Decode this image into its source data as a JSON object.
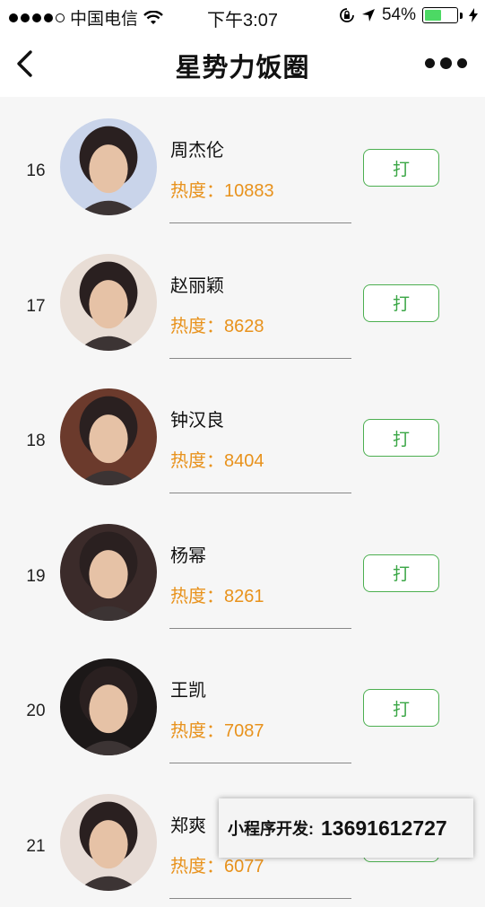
{
  "status_bar": {
    "carrier": "中国电信",
    "time": "下午3:07",
    "battery": "54%",
    "battery_level": 0.54,
    "icons": [
      "signal-dots-icon",
      "wifi-icon",
      "orientation-lock-icon",
      "location-arrow-icon",
      "battery-icon",
      "charging-bolt-icon"
    ]
  },
  "nav": {
    "title": "星势力饭圈",
    "back_icon": "chevron-left-icon",
    "more_icon": "more-dots-icon"
  },
  "heat_label": "热度：",
  "vote_label": "打",
  "items": [
    {
      "rank": "16",
      "name": "周杰伦",
      "heat": "10883",
      "avatar_bg": "#c9d4ea"
    },
    {
      "rank": "17",
      "name": "赵丽颖",
      "heat": "8628",
      "avatar_bg": "#e8ddd5"
    },
    {
      "rank": "18",
      "name": "钟汉良",
      "heat": "8404",
      "avatar_bg": "#6b3a2c"
    },
    {
      "rank": "19",
      "name": "杨幂",
      "heat": "8261",
      "avatar_bg": "#3b2b2a"
    },
    {
      "rank": "20",
      "name": "王凯",
      "heat": "7087",
      "avatar_bg": "#1c1818"
    },
    {
      "rank": "21",
      "name": "郑爽",
      "heat": "6077",
      "avatar_bg": "#e7dcd6"
    }
  ],
  "overlay": {
    "label": "小程序开发:",
    "phone": "13691612727"
  },
  "colors": {
    "heat": "#e8921c",
    "vote_border": "#4caf50",
    "battery_fill": "#4cd964"
  }
}
